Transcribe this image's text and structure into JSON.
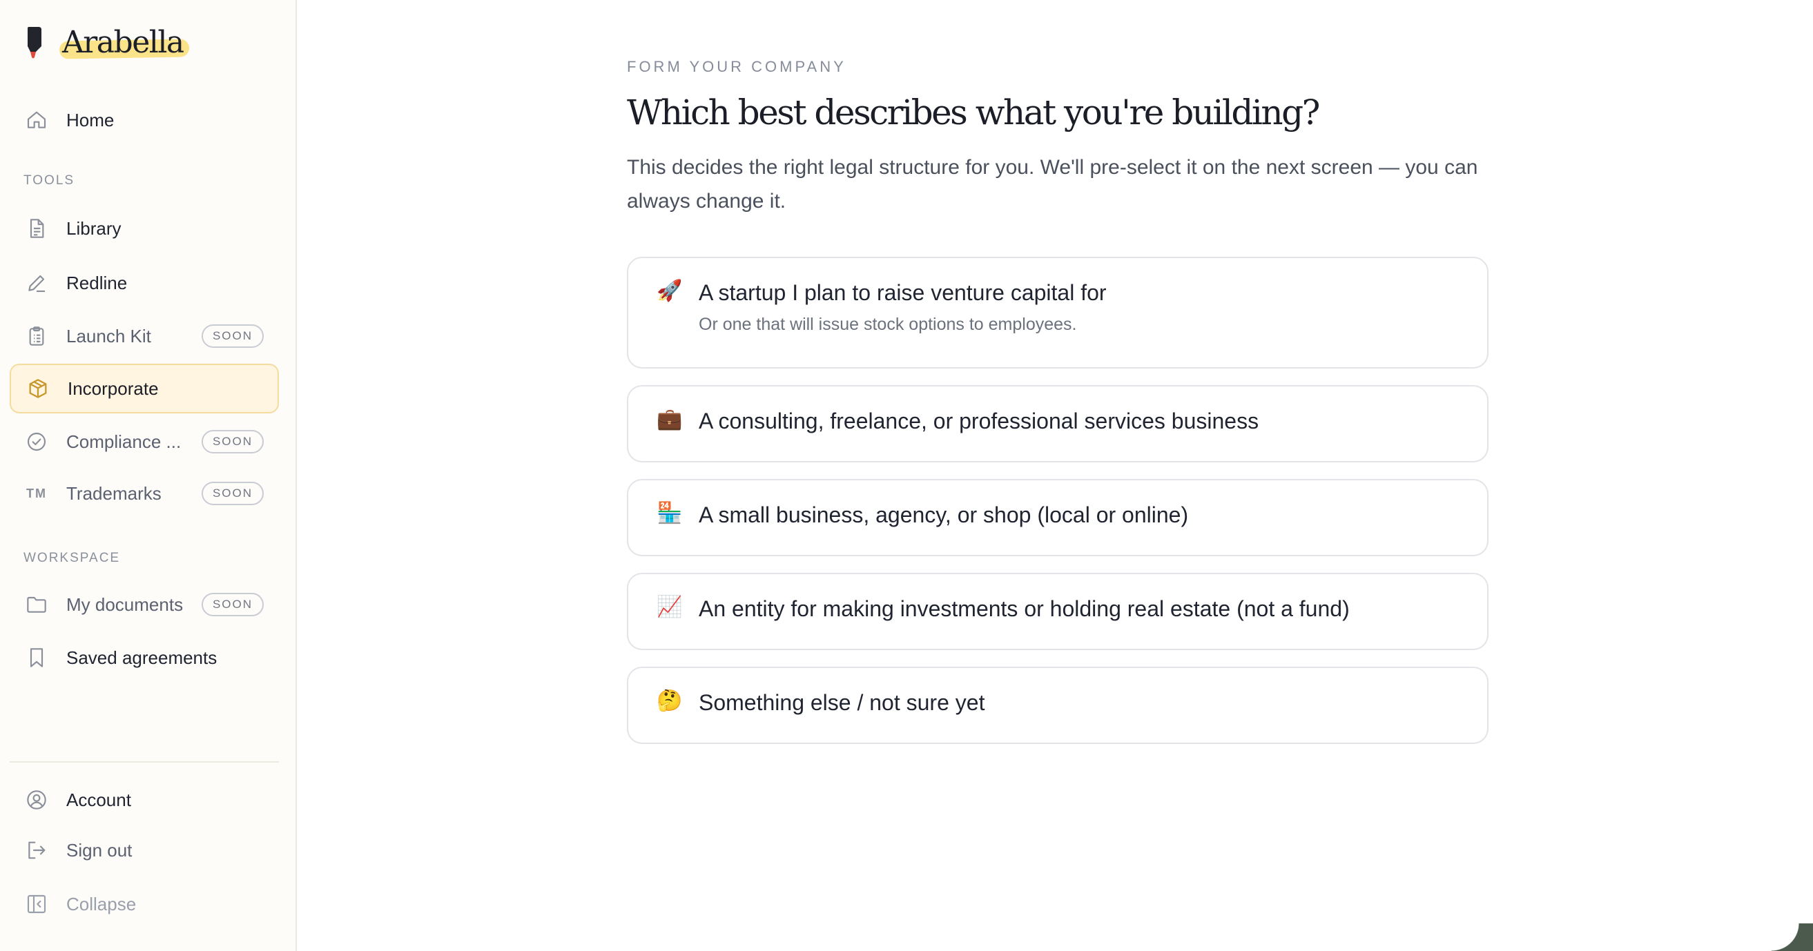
{
  "brand": {
    "name": "Arabella",
    "logo_icon": "marker-pen-icon"
  },
  "sidebar": {
    "home": {
      "label": "Home",
      "icon": "home-icon"
    },
    "tools_label": "TOOLS",
    "tools": [
      {
        "label": "Library",
        "icon": "document-icon",
        "badge": ""
      },
      {
        "label": "Redline",
        "icon": "pen-icon",
        "badge": ""
      },
      {
        "label": "Launch Kit",
        "icon": "clipboard-icon",
        "badge": "SOON"
      },
      {
        "label": "Incorporate",
        "icon": "package-icon",
        "badge": "",
        "active": true
      },
      {
        "label": "Compliance ...",
        "icon": "check-circle-icon",
        "badge": "SOON"
      },
      {
        "label": "Trademarks",
        "icon": "trademark-icon",
        "icon_text": "TM",
        "badge": "SOON"
      }
    ],
    "workspace_label": "WORKSPACE",
    "workspace": [
      {
        "label": "My documents",
        "icon": "folder-icon",
        "badge": "SOON"
      },
      {
        "label": "Saved agreements",
        "icon": "bookmark-icon",
        "badge": ""
      }
    ],
    "footer": [
      {
        "label": "Account",
        "icon": "user-circle-icon"
      },
      {
        "label": "Sign out",
        "icon": "sign-out-icon"
      },
      {
        "label": "Collapse",
        "icon": "collapse-sidebar-icon"
      }
    ]
  },
  "main": {
    "eyebrow": "FORM YOUR COMPANY",
    "title": "Which best describes what you're building?",
    "subtitle": "This decides the right legal structure for you. We'll pre-select it on the next screen — you can always change it.",
    "options": [
      {
        "emoji": "🚀",
        "icon": "rocket-icon",
        "title": "A startup I plan to raise venture capital for",
        "description": "Or one that will issue stock options to employees."
      },
      {
        "emoji": "💼",
        "icon": "briefcase-icon",
        "title": "A consulting, freelance, or professional services business",
        "description": ""
      },
      {
        "emoji": "🏪",
        "icon": "storefront-icon",
        "title": "A small business, agency, or shop (local or online)",
        "description": ""
      },
      {
        "emoji": "📈",
        "icon": "chart-increasing-icon",
        "title": "An entity for making investments or holding real estate (not a fund)",
        "description": ""
      },
      {
        "emoji": "🤔",
        "icon": "thinking-face-icon",
        "title": "Something else / not sure yet",
        "description": ""
      }
    ]
  },
  "colors": {
    "accent_highlight": "#fbe38a",
    "active_bg": "#fff5e1",
    "active_border": "#f5dc9e",
    "sidebar_bg": "#fdfcf8"
  }
}
